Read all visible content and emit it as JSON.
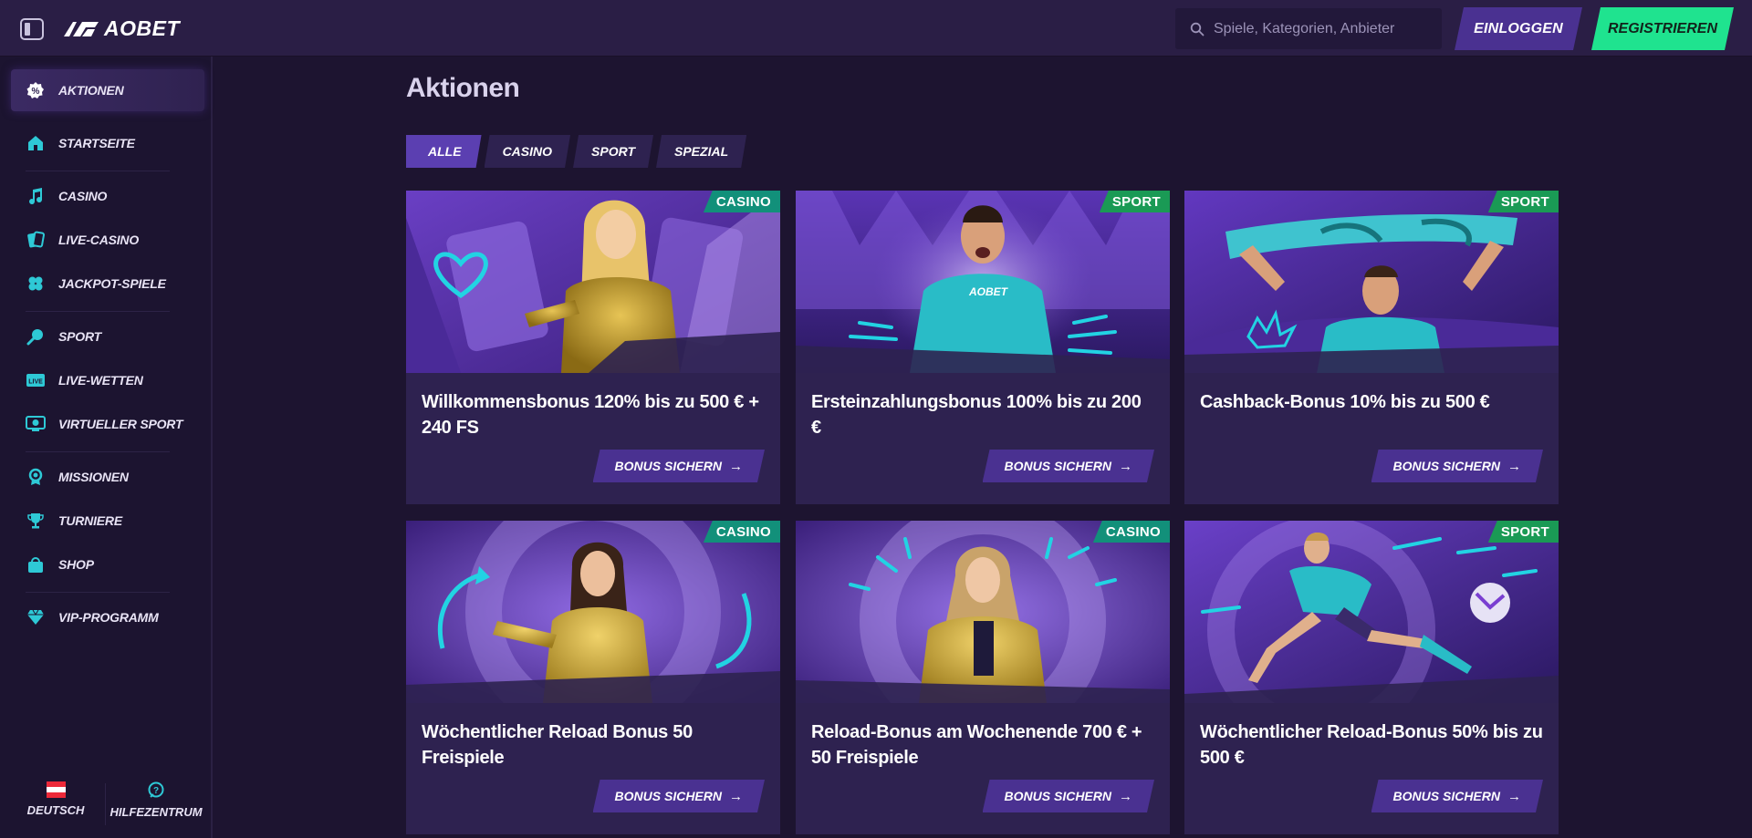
{
  "header": {
    "logo_text": "AOBET",
    "search_placeholder": "Spiele, Kategorien, Anbieter",
    "login_label": "EINLOGGEN",
    "register_label": "REGISTRIEREN",
    "accent_color": "#1fe38f"
  },
  "sidebar": {
    "items": [
      {
        "label": "AKTIONEN",
        "icon": "percent-badge-icon",
        "active": true
      },
      {
        "label": "STARTSEITE",
        "icon": "home-icon"
      },
      {
        "label": "CASINO",
        "icon": "music-note-icon"
      },
      {
        "label": "LIVE-CASINO",
        "icon": "cards-icon"
      },
      {
        "label": "JACKPOT-SPIELE",
        "icon": "clover-icon"
      },
      {
        "label": "SPORT",
        "icon": "sport-ball-icon"
      },
      {
        "label": "LIVE-WETTEN",
        "icon": "live-icon"
      },
      {
        "label": "VIRTUELLER SPORT",
        "icon": "virtual-sport-icon"
      },
      {
        "label": "MISSIONEN",
        "icon": "medal-icon"
      },
      {
        "label": "TURNIERE",
        "icon": "trophy-icon"
      },
      {
        "label": "SHOP",
        "icon": "shopping-bag-icon"
      },
      {
        "label": "VIP-PROGRAMM",
        "icon": "diamond-icon"
      }
    ],
    "language_label": "DEUTSCH",
    "help_label": "HILFEZENTRUM"
  },
  "main": {
    "title": "Aktionen",
    "tabs": [
      {
        "label": "ALLE",
        "active": true
      },
      {
        "label": "CASINO"
      },
      {
        "label": "SPORT"
      },
      {
        "label": "SPEZIAL"
      }
    ],
    "cards": [
      {
        "tag": "CASINO",
        "title": "Willkommensbonus 120% bis zu 500 € + 240 FS",
        "button": "BONUS SICHERN"
      },
      {
        "tag": "SPORT",
        "title": "Ersteinzahlungsbonus 100% bis zu 200 €",
        "button": "BONUS SICHERN"
      },
      {
        "tag": "SPORT",
        "title": "Cashback-Bonus 10% bis zu 500 €",
        "button": "BONUS SICHERN"
      },
      {
        "tag": "CASINO",
        "title": "Wöchentlicher Reload Bonus 50 Freispiele",
        "button": "BONUS SICHERN"
      },
      {
        "tag": "CASINO",
        "title": "Reload-Bonus am Wochenende 700 € + 50 Freispiele",
        "button": "BONUS SICHERN"
      },
      {
        "tag": "SPORT",
        "title": "Wöchentlicher Reload-Bonus 50% bis zu 500 €",
        "button": "BONUS SICHERN"
      }
    ]
  }
}
